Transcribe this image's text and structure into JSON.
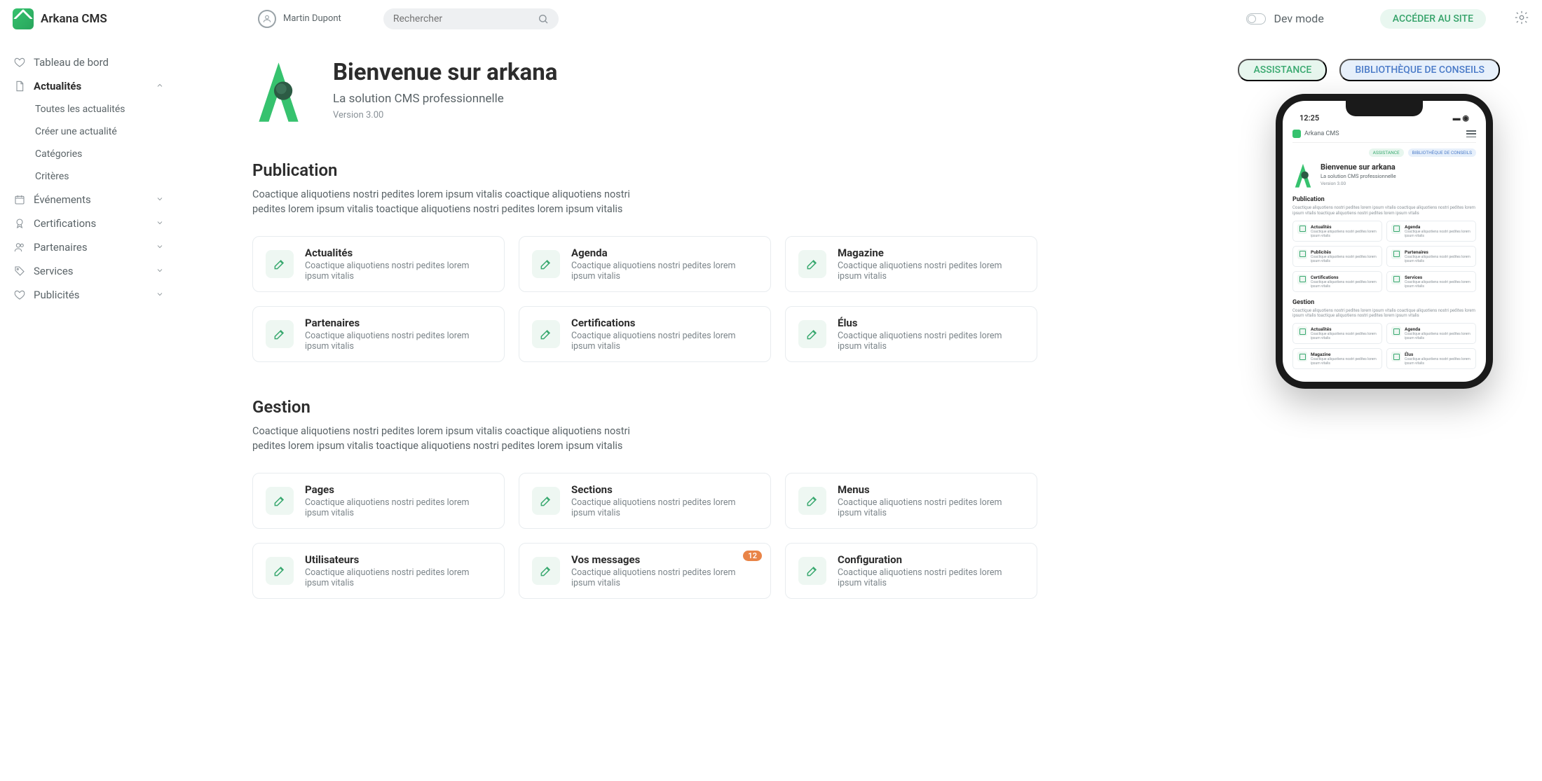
{
  "header": {
    "brandName": "Arkana CMS",
    "userName": "Martin Dupont",
    "searchPlaceholder": "Rechercher",
    "devModeLabel": "Dev mode",
    "siteButton": "ACCÉDER AU SITE"
  },
  "sidebar": {
    "dashboard": "Tableau de bord",
    "items": [
      {
        "label": "Actualités",
        "expanded": true,
        "children": [
          {
            "label": "Toutes les actualités"
          },
          {
            "label": "Créer une actualité"
          },
          {
            "label": "Catégories"
          },
          {
            "label": "Critères"
          }
        ]
      },
      {
        "label": "Événements"
      },
      {
        "label": "Certifications"
      },
      {
        "label": "Partenaires"
      },
      {
        "label": "Services"
      },
      {
        "label": "Publicités"
      }
    ]
  },
  "welcome": {
    "title": "Bienvenue sur arkana",
    "subtitle": "La solution CMS professionnelle",
    "version": "Version 3.00",
    "pillAssistance": "ASSISTANCE",
    "pillLibrary": "BIBLIOTHÈQUE DE CONSEILS"
  },
  "sections": [
    {
      "title": "Publication",
      "desc": "Coactique aliquotiens nostri pedites lorem ipsum vitalis coactique aliquotiens nostri pedites lorem ipsum vitalis toactique aliquotiens nostri pedites lorem ipsum vitalis",
      "cards": [
        {
          "title": "Actualités",
          "sub": "Coactique aliquotiens nostri pedites lorem ipsum vitalis"
        },
        {
          "title": "Agenda",
          "sub": "Coactique aliquotiens nostri pedites lorem ipsum vitalis"
        },
        {
          "title": "Magazine",
          "sub": "Coactique aliquotiens nostri pedites lorem ipsum vitalis"
        },
        {
          "title": "Partenaires",
          "sub": "Coactique aliquotiens nostri pedites lorem ipsum vitalis"
        },
        {
          "title": "Certifications",
          "sub": "Coactique aliquotiens nostri pedites lorem ipsum vitalis"
        },
        {
          "title": "Élus",
          "sub": "Coactique aliquotiens nostri pedites lorem ipsum vitalis"
        }
      ]
    },
    {
      "title": "Gestion",
      "desc": "Coactique aliquotiens nostri pedites lorem ipsum vitalis coactique aliquotiens nostri pedites lorem ipsum vitalis toactique aliquotiens nostri pedites lorem ipsum vitalis",
      "cards": [
        {
          "title": "Pages",
          "sub": "Coactique aliquotiens nostri pedites lorem ipsum vitalis"
        },
        {
          "title": "Sections",
          "sub": "Coactique aliquotiens nostri pedites lorem ipsum vitalis"
        },
        {
          "title": "Menus",
          "sub": "Coactique aliquotiens nostri pedites lorem ipsum vitalis"
        },
        {
          "title": "Utilisateurs",
          "sub": "Coactique aliquotiens nostri pedites lorem ipsum vitalis"
        },
        {
          "title": "Vos messages",
          "sub": "Coactique aliquotiens nostri pedites lorem ipsum vitalis",
          "badge": "12"
        },
        {
          "title": "Configuration",
          "sub": "Coactique aliquotiens nostri pedites lorem ipsum vitalis"
        }
      ]
    }
  ],
  "phone": {
    "time": "12:25",
    "brand": "Arkana CMS",
    "pillA": "ASSISTANCE",
    "pillB": "BIBLIOTHÈQUE DE CONSEILS",
    "title": "Bienvenue sur arkana",
    "sub1": "La solution CMS professionnelle",
    "sub2": "Version 3.00",
    "sec1": "Publication",
    "sec1desc": "Coactique aliquotiens nostri pedites lorem ipsum vitalis coactique aliquotiens nostri pedites lorem ipsum vitalis toactique aliquotiens nostri pedites lorem ipsum vitalis",
    "cards1": [
      {
        "t": "Actualités",
        "s": "Coactique aliquotiens nostri pedites lorem ipsum vitalis"
      },
      {
        "t": "Agenda",
        "s": "Coactique aliquotiens nostri pedites lorem ipsum vitalis"
      },
      {
        "t": "Publicités",
        "s": "Coactique aliquotiens nostri pedites lorem ipsum vitalis"
      },
      {
        "t": "Partenaires",
        "s": "Coactique aliquotiens nostri pedites lorem ipsum vitalis"
      },
      {
        "t": "Certifications",
        "s": "Coactique aliquotiens nostri pedites lorem ipsum vitalis"
      },
      {
        "t": "Services",
        "s": "Coactique aliquotiens nostri pedites lorem ipsum vitalis"
      }
    ],
    "sec2": "Gestion",
    "sec2desc": "Coactique aliquotiens nostri pedites lorem ipsum vitalis coactique aliquotiens nostri pedites lorem ipsum vitalis toactique aliquotiens nostri pedites lorem ipsum vitalis",
    "cards2": [
      {
        "t": "Actualités",
        "s": "Coactique aliquotiens nostri pedites lorem ipsum vitalis"
      },
      {
        "t": "Agenda",
        "s": "Coactique aliquotiens nostri pedites lorem ipsum vitalis"
      },
      {
        "t": "Magazine",
        "s": "Coactique aliquotiens nostri pedites lorem ipsum vitalis"
      },
      {
        "t": "Élus",
        "s": "Coactique aliquotiens nostri pedites lorem ipsum vitalis"
      }
    ]
  },
  "colors": {
    "accent": "#36c26e",
    "pillGreenBg": "#e7f6ee",
    "pillBlueBg": "#e7f0fb",
    "badge": "#e98447"
  }
}
